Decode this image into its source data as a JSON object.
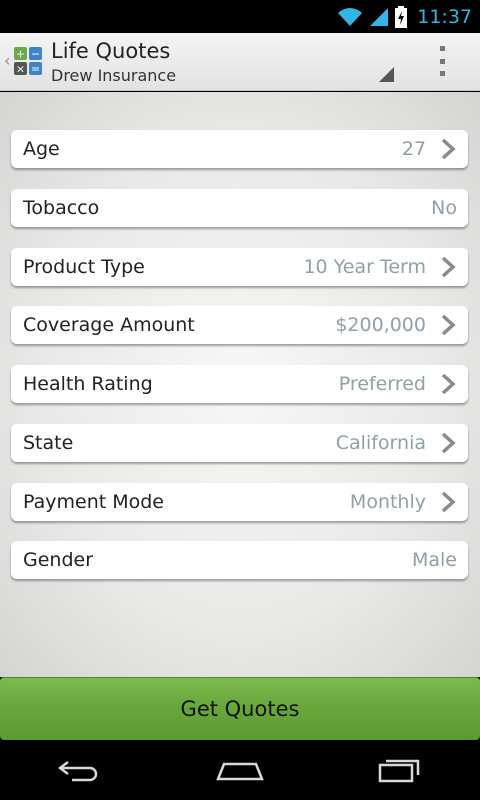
{
  "status": {
    "time": "11:37"
  },
  "header": {
    "title": "Life Quotes",
    "subtitle": "Drew Insurance"
  },
  "fields": [
    {
      "label": "Age",
      "value": "27"
    },
    {
      "label": "Tobacco",
      "value": "No"
    },
    {
      "label": "Product Type",
      "value": "10 Year Term"
    },
    {
      "label": "Coverage Amount",
      "value": "$200,000"
    },
    {
      "label": "Health Rating",
      "value": "Preferred"
    },
    {
      "label": "State",
      "value": "California"
    },
    {
      "label": "Payment Mode",
      "value": "Monthly"
    },
    {
      "label": "Gender",
      "value": "Male"
    }
  ],
  "actions": {
    "get_quotes": "Get Quotes"
  },
  "colors": {
    "accent": "#33b5e5",
    "button": "#6aaa3c",
    "value_text": "#8fa0a6"
  }
}
